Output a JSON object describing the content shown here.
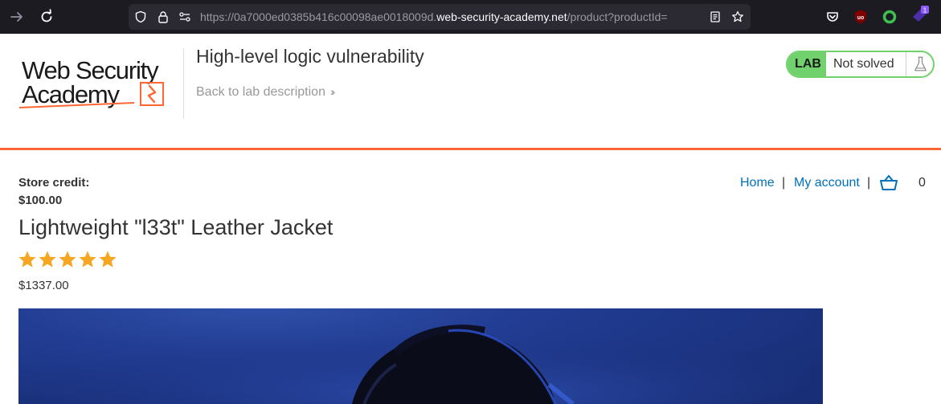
{
  "browser": {
    "url_prefix": "https://0a7000ed0385b416c00098ae0018009d.",
    "url_host": "web-security-academy.net",
    "url_path": "/product?productId=",
    "extension_badge": "1",
    "ublock_label": "uo"
  },
  "lab": {
    "logo_line1": "Web Security",
    "logo_line2": "Academy",
    "title": "High-level logic vulnerability",
    "back_link": "Back to lab description",
    "badge_lab": "LAB",
    "badge_status": "Not solved"
  },
  "account": {
    "credit_label": "Store credit:",
    "credit_value": "$100.00"
  },
  "nav": {
    "home": "Home",
    "separator": "|",
    "my_account": "My account",
    "cart_count": "0"
  },
  "product": {
    "name": "Lightweight \"l33t\" Leather Jacket",
    "rating": 5,
    "rating_max": 5,
    "price": "$1337.00"
  },
  "colors": {
    "accent_orange": "#ff6633",
    "lab_green": "#70d16d",
    "link_blue": "#0071bc",
    "star_gold": "#f5a623"
  }
}
